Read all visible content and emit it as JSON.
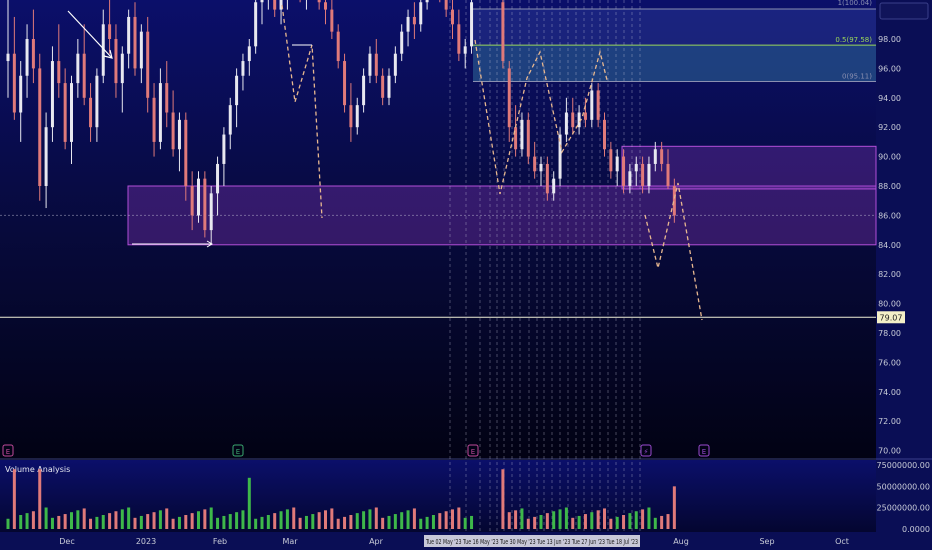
{
  "chart_data": {
    "type": "candlestick",
    "price_axis": {
      "min": 70,
      "max": 100,
      "ticks": [
        "98.00",
        "96.00",
        "94.00",
        "92.00",
        "90.00",
        "88.00",
        "86.00",
        "84.00",
        "82.00",
        "80.00",
        "78.00",
        "76.00",
        "74.00",
        "72.00",
        "70.00"
      ],
      "top_label": "1(100.04)"
    },
    "x_axis": {
      "labels": [
        "Dec",
        "2023",
        "Feb",
        "Mar",
        "Apr",
        "Aug",
        "Sep",
        "Oct"
      ],
      "highlighted_dates": "Tue 02 May '23  Tue 16 May '23  Tue 30 May '23  Tue 13 Jun '23  Tue 27 Jun '23  Tue 18 Jul '23"
    },
    "current_price": {
      "value": 79.07,
      "label": "79.07"
    },
    "fib_levels": [
      {
        "label": "1(100.04)",
        "value": 100.04,
        "color": "#8a8fb0"
      },
      {
        "label": "0.5(97.58)",
        "value": 97.58,
        "color": "#9bd85a"
      },
      {
        "label": "0(95.11)",
        "value": 95.11,
        "color": "#8a8fb0"
      }
    ],
    "zones": [
      {
        "name": "demand zone",
        "top": 88.0,
        "bottom": 84.0
      },
      {
        "name": "supply zone",
        "top": 90.7,
        "bottom": 87.8
      }
    ],
    "candles": [
      [
        96.5,
        101,
        94,
        97
      ],
      [
        97,
        99.5,
        92.5,
        93
      ],
      [
        93,
        96.5,
        91,
        95.5
      ],
      [
        95.5,
        99,
        94,
        98
      ],
      [
        98,
        100,
        95,
        96
      ],
      [
        96,
        97,
        87,
        88
      ],
      [
        88,
        93,
        86.5,
        92
      ],
      [
        92,
        97.5,
        91,
        96.5
      ],
      [
        96.5,
        99,
        94,
        95
      ],
      [
        95,
        96,
        90.5,
        91
      ],
      [
        91,
        95.5,
        89.5,
        95
      ],
      [
        95,
        98,
        94,
        97
      ],
      [
        97,
        99,
        93.5,
        94
      ],
      [
        94,
        95,
        91,
        92
      ],
      [
        92,
        96,
        91,
        95.5
      ],
      [
        95.5,
        100,
        95,
        99
      ],
      [
        99,
        101,
        97,
        98
      ],
      [
        98,
        99,
        94,
        95
      ],
      [
        95,
        97.5,
        93,
        97
      ],
      [
        97,
        100,
        96,
        99.5
      ],
      [
        99.5,
        100.5,
        95.5,
        96
      ],
      [
        96,
        99,
        95,
        98.5
      ],
      [
        98.5,
        99.5,
        93,
        94
      ],
      [
        94,
        95,
        90,
        91
      ],
      [
        91,
        96,
        90.5,
        95
      ],
      [
        95,
        96.5,
        92,
        93
      ],
      [
        93,
        94.5,
        90,
        90.5
      ],
      [
        90.5,
        93,
        89,
        92.5
      ],
      [
        92.5,
        93,
        87,
        88
      ],
      [
        88,
        89,
        85,
        86
      ],
      [
        86,
        89,
        85.5,
        88.5
      ],
      [
        88.5,
        89,
        84.5,
        85
      ],
      [
        85,
        88,
        84,
        87.5
      ],
      [
        87.5,
        90,
        86,
        89.5
      ],
      [
        89.5,
        92,
        88,
        91.5
      ],
      [
        91.5,
        94,
        90.5,
        93.5
      ],
      [
        93.5,
        96,
        92,
        95.5
      ],
      [
        95.5,
        97,
        94.5,
        96.5
      ],
      [
        96.5,
        98,
        95.5,
        97.5
      ],
      [
        97.5,
        101,
        97,
        100.5
      ],
      [
        100.5,
        102,
        99,
        101.5
      ],
      [
        101.5,
        103,
        100,
        102
      ],
      [
        102,
        103,
        99.5,
        100
      ],
      [
        100,
        102,
        99,
        101.5
      ],
      [
        101.5,
        103,
        100,
        102.5
      ],
      [
        102.5,
        103.5,
        101,
        102
      ],
      [
        102,
        103,
        100.5,
        101
      ],
      [
        101,
        102.5,
        100,
        102
      ],
      [
        102,
        103,
        101,
        102.5
      ],
      [
        102.5,
        103,
        100,
        100.5
      ],
      [
        100.5,
        101.5,
        99,
        100
      ],
      [
        100,
        101,
        98,
        98.5
      ],
      [
        98.5,
        99,
        96,
        96.5
      ],
      [
        96.5,
        97,
        93,
        93.5
      ],
      [
        93.5,
        95,
        91,
        92
      ],
      [
        92,
        94,
        91.5,
        93.5
      ],
      [
        93.5,
        96,
        93,
        95.5
      ],
      [
        95.5,
        97.5,
        95,
        97
      ],
      [
        97,
        98,
        95,
        95.5
      ],
      [
        95.5,
        96,
        93.5,
        94
      ],
      [
        94,
        96,
        93.5,
        95.5
      ],
      [
        95.5,
        97.5,
        95,
        97
      ],
      [
        97,
        99,
        96.5,
        98.5
      ],
      [
        98.5,
        100,
        97.5,
        99.5
      ],
      [
        99.5,
        100.5,
        98,
        99
      ],
      [
        99,
        101,
        98.5,
        100.5
      ],
      [
        100.5,
        102,
        100,
        101.5
      ],
      [
        101.5,
        103,
        101,
        102.5
      ],
      [
        102.5,
        103,
        100.5,
        101
      ],
      [
        101,
        102,
        99.5,
        100
      ],
      [
        100,
        101,
        98,
        99
      ],
      [
        99,
        100,
        96.5,
        97
      ],
      [
        97,
        98,
        96,
        97.5
      ],
      [
        97.5,
        101,
        97,
        100.5
      ],
      [
        100.5,
        101,
        96,
        96.5
      ],
      [
        96,
        96.5,
        91,
        92
      ],
      [
        92,
        93.5,
        90,
        90.5
      ],
      [
        90.5,
        93,
        90,
        92.5
      ],
      [
        92.5,
        93,
        89.5,
        90
      ],
      [
        90,
        91,
        88.5,
        89
      ],
      [
        89,
        90,
        88,
        89.5
      ],
      [
        89.5,
        90,
        87,
        87.5
      ],
      [
        87.5,
        89,
        87,
        88.5
      ],
      [
        88.5,
        92,
        88,
        91.5
      ],
      [
        91.5,
        94,
        91,
        93
      ],
      [
        93,
        94,
        91.5,
        92
      ],
      [
        92,
        93.5,
        91.5,
        93
      ],
      [
        93,
        94,
        92,
        92.5
      ],
      [
        92.5,
        95,
        92,
        94.5
      ],
      [
        94.5,
        95,
        92,
        92.5
      ],
      [
        92.5,
        93,
        90,
        90.5
      ],
      [
        90.5,
        91,
        88.5,
        89
      ],
      [
        89,
        90.5,
        88,
        90
      ],
      [
        90,
        90.5,
        87.5,
        88
      ],
      [
        88,
        89.5,
        87.5,
        89
      ],
      [
        89,
        90,
        88,
        89.5
      ],
      [
        89.5,
        90,
        87.5,
        88
      ],
      [
        88,
        90,
        87.5,
        89.5
      ],
      [
        89.5,
        91,
        89,
        90.5
      ],
      [
        90.5,
        91,
        89,
        89.5
      ],
      [
        89.5,
        90.5,
        87.8,
        88
      ],
      [
        88,
        88.5,
        85.5,
        86
      ]
    ],
    "volume": {
      "axis_ticks": [
        "75000000.00",
        "50000000.00",
        "25000000.00",
        "0.0000"
      ],
      "max": 75000000,
      "title": "Volume Analysis"
    },
    "earnings_markers": [
      "E",
      "E",
      "E",
      "⚡",
      "E"
    ]
  }
}
